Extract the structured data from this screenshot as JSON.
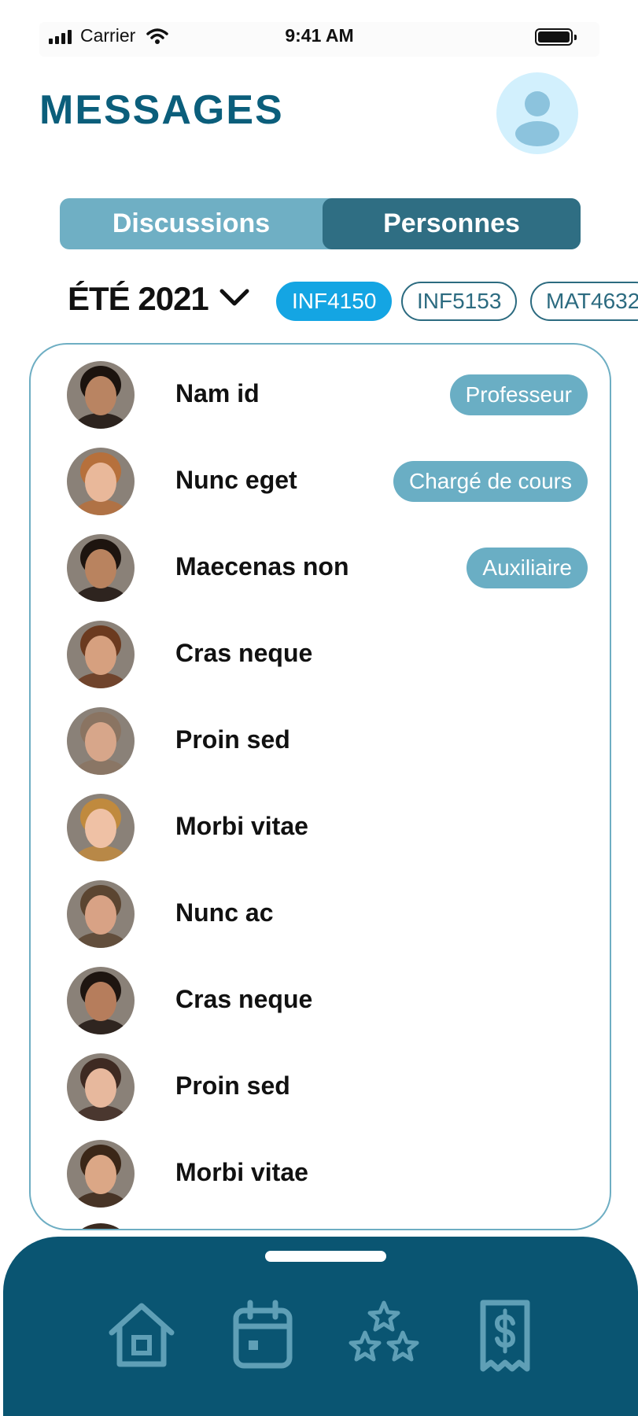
{
  "status_bar": {
    "carrier": "Carrier",
    "time": "9:41 AM",
    "battery": 1.0
  },
  "header": {
    "title": "MESSAGES"
  },
  "tabs": [
    {
      "label": "Discussions",
      "active": false
    },
    {
      "label": "Personnes",
      "active": true
    }
  ],
  "filter": {
    "term": "ÉTÉ 2021",
    "courses": [
      "INF4150",
      "INF5153",
      "MAT4632"
    ],
    "active_course": "INF4150"
  },
  "people": [
    {
      "name": "Nam id",
      "role": "Professeur",
      "skin": "#b98462",
      "hair": "#1b130e"
    },
    {
      "name": "Nunc eget",
      "role": "Chargé de cours",
      "skin": "#e9b89a",
      "hair": "#b6703c"
    },
    {
      "name": "Maecenas non",
      "role": "Auxiliaire",
      "skin": "#b9835f",
      "hair": "#1d140f"
    },
    {
      "name": "Cras neque",
      "role": "",
      "skin": "#d6a07f",
      "hair": "#6b3a1f"
    },
    {
      "name": "Proin sed",
      "role": "",
      "skin": "#d7a68a",
      "hair": "#8a7462"
    },
    {
      "name": "Morbi vitae",
      "role": "",
      "skin": "#efc1a5",
      "hair": "#c08a3e"
    },
    {
      "name": "Nunc ac",
      "role": "",
      "skin": "#d8a285",
      "hair": "#5b4531"
    },
    {
      "name": "Cras neque",
      "role": "",
      "skin": "#b67d5c",
      "hair": "#1e1510"
    },
    {
      "name": "Proin sed",
      "role": "",
      "skin": "#e7b89d",
      "hair": "#3e2a22"
    },
    {
      "name": "Morbi vitae",
      "role": "",
      "skin": "#dba786",
      "hair": "#3b2718"
    }
  ],
  "bottom_nav": {
    "items": [
      {
        "icon": "home-icon"
      },
      {
        "icon": "calendar-icon"
      },
      {
        "icon": "stars-icon"
      },
      {
        "icon": "receipt-dollar-icon"
      }
    ]
  },
  "colors": {
    "title": "#0b5e7b",
    "tab_bg": "#6fafc4",
    "tab_active": "#2f6e83",
    "chip_active": "#14a5e3",
    "badge": "#6aaec4",
    "nav_bg": "#0a5572",
    "nav_icon": "#5f9fb6",
    "avatar_bg": "#d2f0fd"
  }
}
